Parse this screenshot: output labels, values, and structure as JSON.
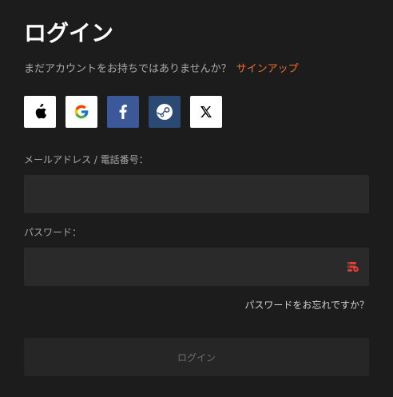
{
  "header": {
    "title": "ログイン"
  },
  "signup": {
    "prompt": "まだアカウントをお持ちではありませんか？",
    "link_label": "サインアップ"
  },
  "social_login": {
    "buttons": [
      {
        "icon": "apple-icon",
        "color": "#ffffff"
      },
      {
        "icon": "google-icon",
        "color": "#ffffff"
      },
      {
        "icon": "facebook-icon",
        "color": "#3b5998"
      },
      {
        "icon": "steam-icon",
        "color": "#2a4a73"
      },
      {
        "icon": "x-icon",
        "color": "#ffffff"
      }
    ]
  },
  "form": {
    "email_label": "メールアドレス / 電話番号：",
    "email_value": "",
    "password_label": "パスワード：",
    "password_value": "",
    "password_toggle_icon": "password-manager-icon",
    "forgot_label": "パスワードをお忘れですか？",
    "submit_label": "ログイン"
  },
  "colors": {
    "background": "#1c1c1c",
    "input_background": "#2a2a2a",
    "accent": "#f26d2d",
    "muted_text": "#a9a9a9",
    "icon_red": "#d9413a"
  }
}
